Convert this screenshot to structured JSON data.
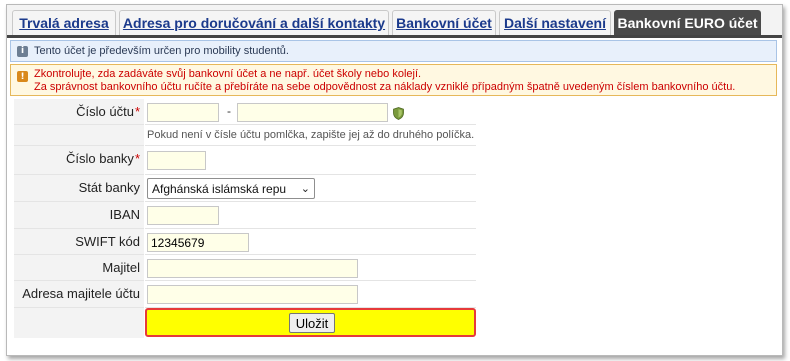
{
  "tabs": [
    {
      "label": "Trvalá adresa"
    },
    {
      "label": "Adresa pro doručování a další kontakty"
    },
    {
      "label": "Bankovní účet"
    },
    {
      "label": "Další nastavení"
    },
    {
      "label": "Bankovní EURO účet",
      "active": true
    }
  ],
  "messages": {
    "info": {
      "icon": "info-icon",
      "text": "Tento účet je především určen pro mobility studentů."
    },
    "warning": {
      "icon": "warning-icon",
      "line1": "Zkontrolujte, zda zadáváte svůj bankovní účet a ne např. účet školy nebo kolejí.",
      "line2": "Za správnost bankovního účtu ručíte a přebíráte na sebe odpovědnost za náklady vzniklé případným špatně uvedeným číslem bankovního účtu."
    }
  },
  "form": {
    "account_number": {
      "label": "Číslo účtu",
      "required_mark": "*",
      "prefix_value": "",
      "main_value": "",
      "separator": "-",
      "hint": "Pokud není v čísle účtu pomlčka, zapište jej až do druhého políčka."
    },
    "bank_code": {
      "label": "Číslo banky",
      "required_mark": "*",
      "value": ""
    },
    "bank_country": {
      "label": "Stát banky",
      "selected": "Afghánská islámská repu"
    },
    "iban": {
      "label": "IBAN",
      "value": ""
    },
    "swift": {
      "label": "SWIFT kód",
      "value": "12345679"
    },
    "owner": {
      "label": "Majitel",
      "value": ""
    },
    "owner_address": {
      "label": "Adresa majitele účtu",
      "value": ""
    },
    "save_label": "Uložit"
  },
  "colors": {
    "tab_active_bg": "#4a4a4a",
    "tab_link": "#1b3a8c",
    "warning_text": "#cc0000",
    "save_highlight": "#ffff00",
    "save_border": "#e63a3a"
  }
}
